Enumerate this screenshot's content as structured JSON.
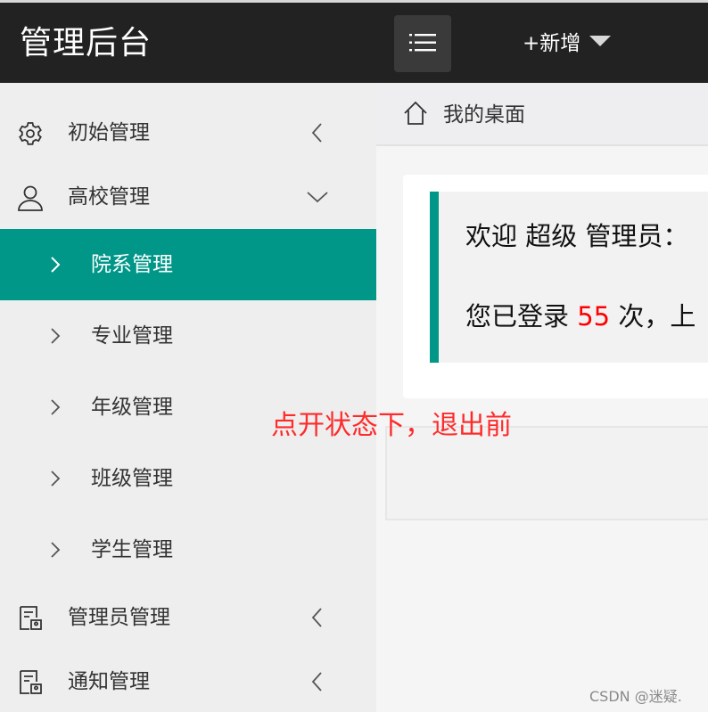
{
  "header": {
    "logo": "管理后台",
    "add_new": "+新增"
  },
  "sidebar": {
    "items": [
      {
        "label": "初始管理",
        "icon": "gear-icon",
        "expanded": false
      },
      {
        "label": "高校管理",
        "icon": "user-icon",
        "expanded": true,
        "children": [
          {
            "label": "院系管理",
            "active": true
          },
          {
            "label": "专业管理"
          },
          {
            "label": "年级管理"
          },
          {
            "label": "班级管理"
          },
          {
            "label": "学生管理"
          }
        ]
      },
      {
        "label": "管理员管理",
        "icon": "id-card-icon",
        "expanded": false
      },
      {
        "label": "通知管理",
        "icon": "id-card-icon",
        "expanded": false
      }
    ]
  },
  "tabs": [
    {
      "label": "我的桌面",
      "icon": "home-icon"
    }
  ],
  "welcome": {
    "greeting": "欢迎 超级 管理员：",
    "login_prefix": "您已登录 ",
    "login_count": "55",
    "login_suffix": " 次，上"
  },
  "annotation": "点开状态下，退出前",
  "watermark": "CSDN @迷疑.",
  "colors": {
    "header_bg": "#222222",
    "accent": "#009688",
    "highlight": "#ff0000"
  }
}
